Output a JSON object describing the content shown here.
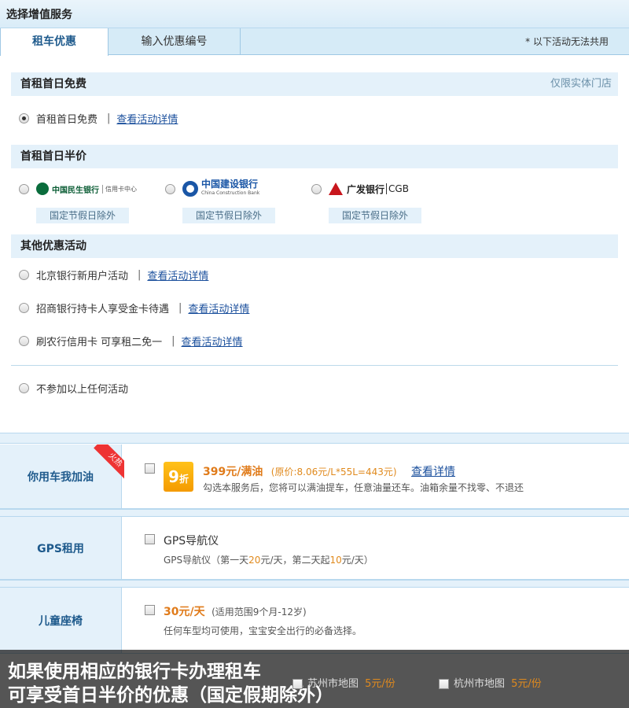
{
  "header": {
    "title": "选择增值服务"
  },
  "tabs": [
    {
      "label": "租车优惠"
    },
    {
      "label": "输入优惠编号"
    }
  ],
  "tab_note": "* 以下活动无法共用",
  "section1": {
    "title": "首租首日免费",
    "right_note": "仅限实体门店",
    "option_label": "首租首日免费",
    "detail_link": "查看活动详情"
  },
  "section2": {
    "title": "首租首日半价",
    "banks": [
      {
        "name": "中国民生银行",
        "extra": "信用卡中心",
        "tag": "国定节假日除外"
      },
      {
        "name": "中国建设银行",
        "extra": "China Construction Bank",
        "tag": "国定节假日除外"
      },
      {
        "name": "广发银行",
        "extra": "CGB",
        "tag": "国定节假日除外"
      }
    ]
  },
  "section3": {
    "title": "其他优惠活动",
    "items": [
      {
        "label": "北京银行新用户活动",
        "link": "查看活动详情"
      },
      {
        "label": "招商银行持卡人享受金卡待遇",
        "link": "查看活动详情"
      },
      {
        "label": "刷农行信用卡 可享租二免一",
        "link": "查看活动详情"
      }
    ],
    "none_label": "不参加以上任何活动"
  },
  "services": {
    "fuel": {
      "label": "你用车我加油",
      "ribbon": "火热",
      "badge_num": "9",
      "badge_unit": "折",
      "price": "399元/满油",
      "original": "(原价:8.06元/L*55L=443元)",
      "link": "查看详情",
      "desc": "勾选本服务后，您将可以满油提车，任意油量还车。油箱余量不找零、不退还"
    },
    "gps": {
      "label": "GPS租用",
      "title": "GPS导航仪",
      "desc_a": "GPS导航仪（第一天",
      "desc_b": "20",
      "desc_c": "元/天，第二天起",
      "desc_d": "10",
      "desc_e": "元/天）"
    },
    "child_seat": {
      "label": "儿童座椅",
      "price": "30元/天",
      "range": "(适用范围9个月-12岁)",
      "desc": "任何车型均可使用，宝宝安全出行的必备选择。"
    },
    "maps": [
      {
        "label": "苏州市地图",
        "price": "5元/份"
      },
      {
        "label": "杭州市地图",
        "price": "5元/份"
      }
    ]
  },
  "caption": {
    "line1": "如果使用相应的银行卡办理租车",
    "line2": "可享受首日半价的优惠（国定假期除外）"
  }
}
